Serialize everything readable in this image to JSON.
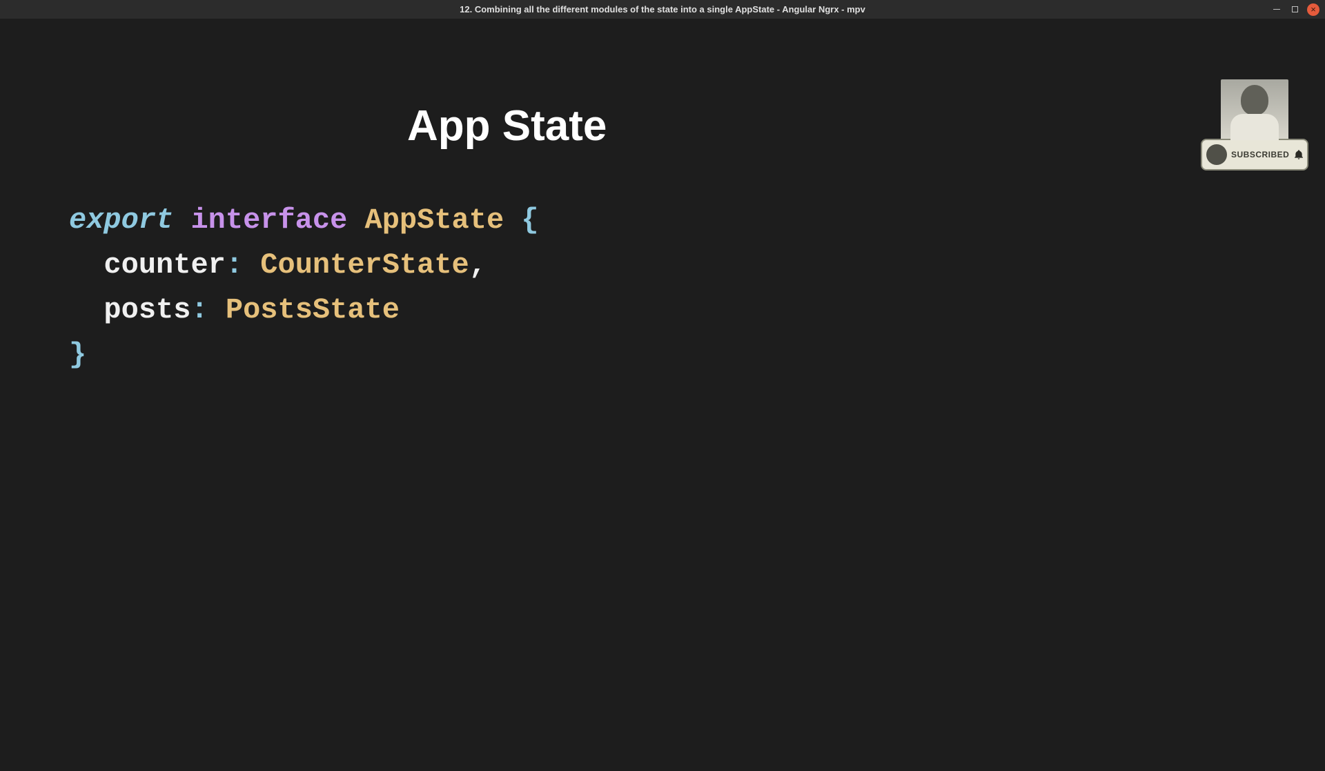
{
  "window": {
    "title": "12. Combining all the different modules of the state into a single AppState - Angular Ngrx - mpv"
  },
  "slide": {
    "heading": "App State"
  },
  "code": {
    "l1": {
      "export": "export",
      "keyword": "interface",
      "type": "AppState",
      "brace": "{"
    },
    "l2": {
      "ident": "counter",
      "colon": ":",
      "type": "CounterState",
      "punct": ","
    },
    "l3": {
      "ident": "posts",
      "colon": ":",
      "type": "PostsState"
    },
    "l4": {
      "brace": "}"
    }
  },
  "overlay": {
    "subscribed_label": "SUBSCRIBED"
  }
}
